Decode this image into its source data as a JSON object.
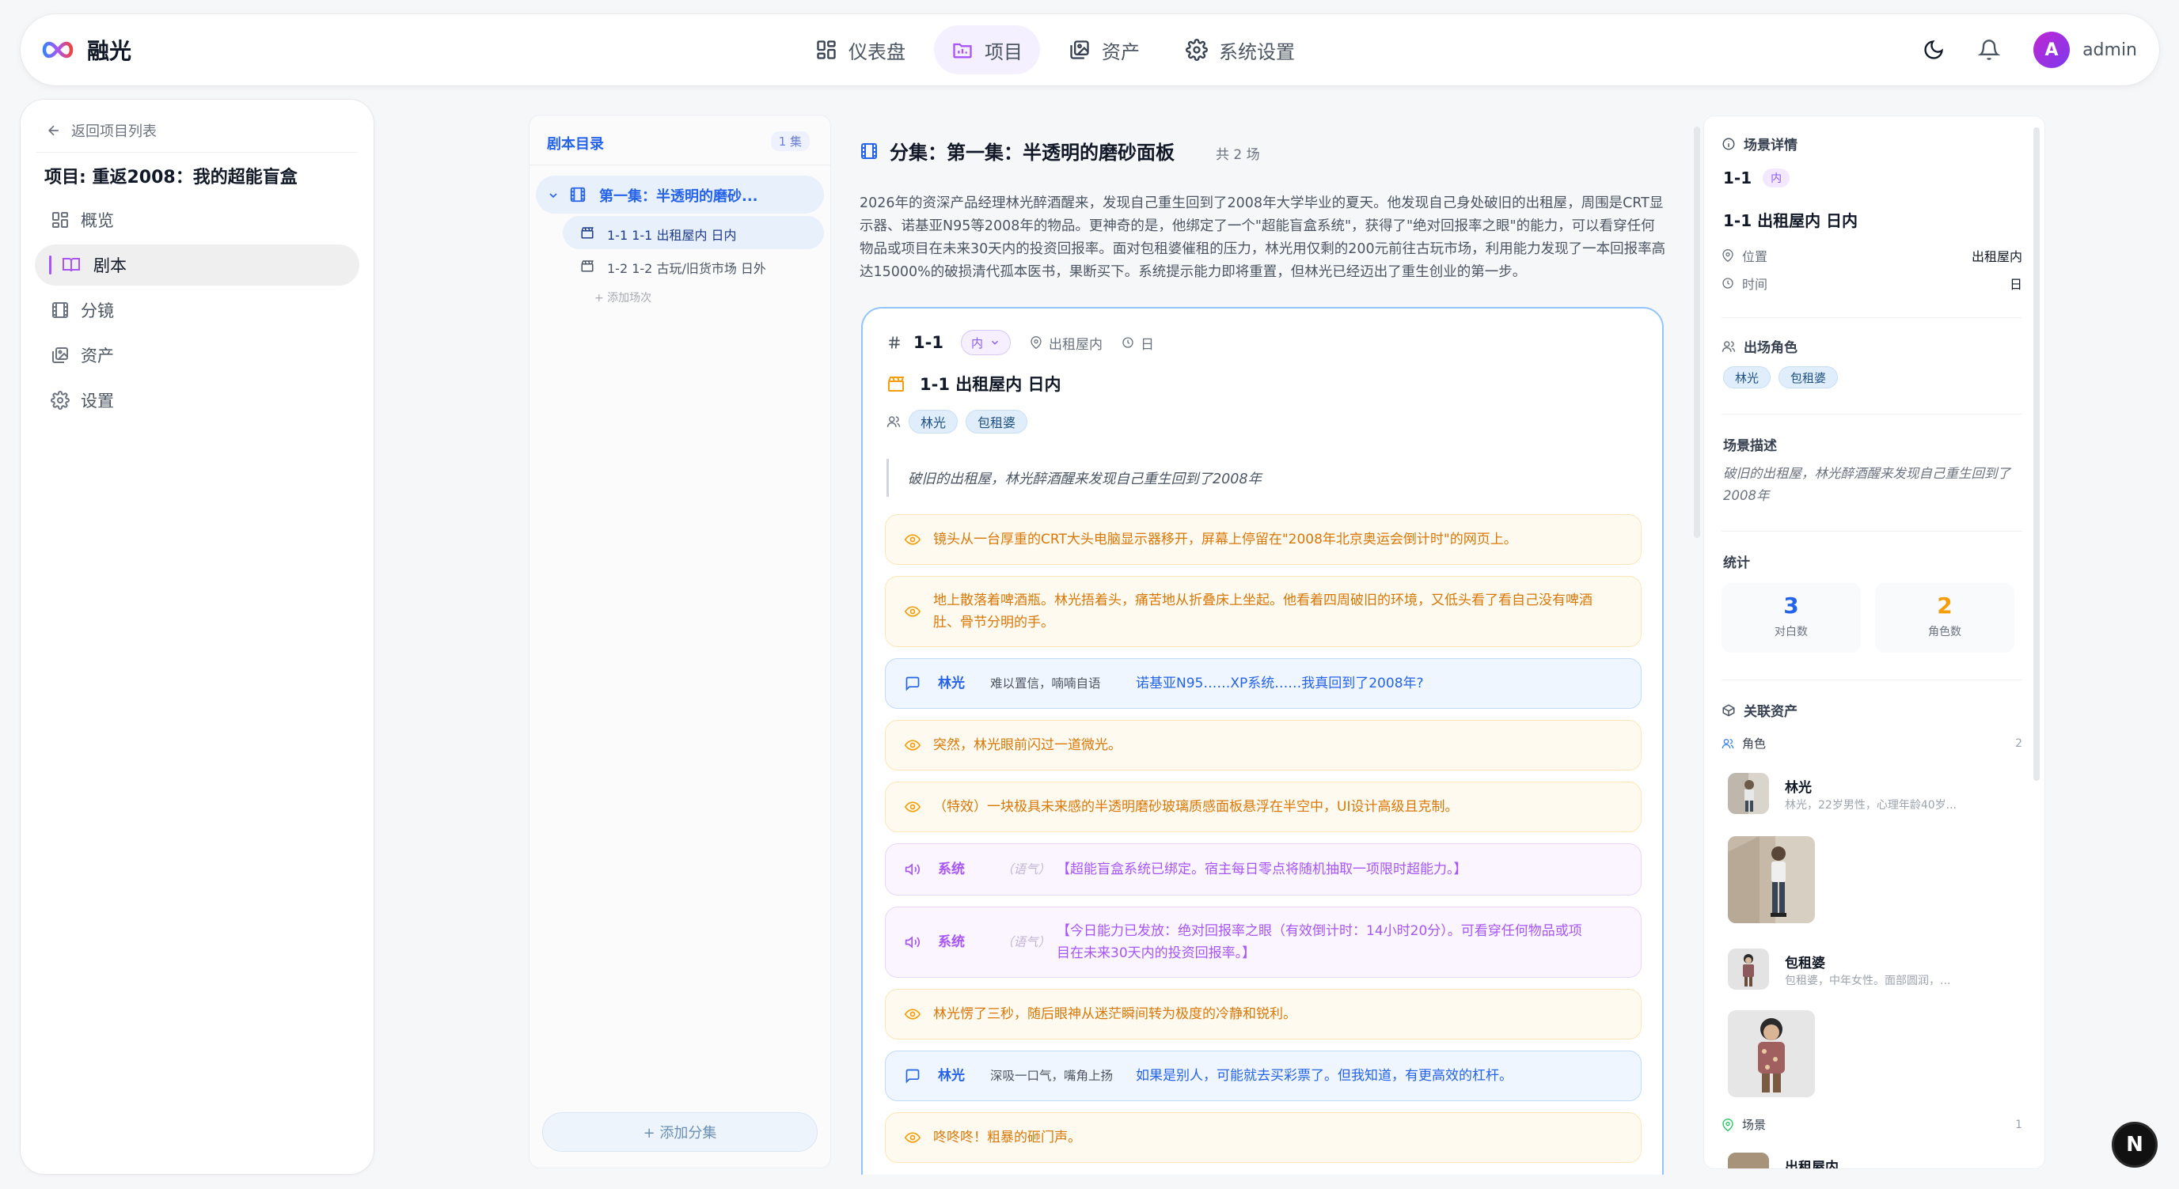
{
  "brand": {
    "name": "融光"
  },
  "nav": [
    {
      "label": "仪表盘",
      "icon": "dashboard-icon"
    },
    {
      "label": "项目",
      "icon": "project-icon",
      "active": true
    },
    {
      "label": "资产",
      "icon": "assets-icon"
    },
    {
      "label": "系统设置",
      "icon": "gear-icon"
    }
  ],
  "user": {
    "avatar_letter": "A",
    "name": "admin"
  },
  "sidebar": {
    "back_label": "返回项目列表",
    "project_title": "项目: 重返2008：我的超能盲盒",
    "items": [
      {
        "label": "概览",
        "icon": "grid-icon"
      },
      {
        "label": "剧本",
        "icon": "book-icon",
        "active": true
      },
      {
        "label": "分镜",
        "icon": "film-icon"
      },
      {
        "label": "资产",
        "icon": "images-icon"
      },
      {
        "label": "设置",
        "icon": "gear-icon"
      }
    ]
  },
  "directory": {
    "title": "剧本目录",
    "count": "1 集",
    "episode_label": "第一集：半透明的磨砂...",
    "scenes": [
      {
        "label": "1-1 1-1 出租屋内 日内"
      },
      {
        "label": "1-2 1-2 古玩/旧货市场 日外"
      }
    ],
    "add_scene": "+ 添加场次",
    "add_episode": "+ 添加分集"
  },
  "main": {
    "title": "分集：第一集：半透明的磨砂面板",
    "scene_count": "共 2 场",
    "synopsis": "2026年的资深产品经理林光醉酒醒来，发现自己重生回到了2008年大学毕业的夏天。他发现自己身处破旧的出租屋，周围是CRT显示器、诺基亚N95等2008年的物品。更神奇的是，他绑定了一个\"超能盲盒系统\"，获得了\"绝对回报率之眼\"的能力，可以看穿任何物品或项目在未来30天内的投资回报率。面对包租婆催租的压力，林光用仅剩的200元前往古玩市场，利用能力发现了一本回报率高达15000%的破损清代孤本医书，果断买下。系统提示能力即将重置，但林光已经迈出了重生创业的第一步。"
  },
  "scene": {
    "number": "1-1",
    "inout": "内",
    "location": "出租屋内",
    "time": "日",
    "heading": "1-1 出租屋内 日内",
    "characters": [
      "林光",
      "包租婆"
    ],
    "description": "破旧的出租屋，林光醉酒醒来发现自己重生回到了2008年",
    "blocks": [
      {
        "type": "action",
        "text": "镜头从一台厚重的CRT大头电脑显示器移开，屏幕上停留在\"2008年北京奥运会倒计时\"的网页上。"
      },
      {
        "type": "action",
        "text": "地上散落着啤酒瓶。林光捂着头，痛苦地从折叠床上坐起。他看着四周破旧的环境，又低头看了看自己没有啤酒肚、骨节分明的手。"
      },
      {
        "type": "dialog",
        "speaker": "林光",
        "paren": "难以置信，喃喃自语",
        "line": "诺基亚N95……XP系统……我真回到了2008年?"
      },
      {
        "type": "action",
        "text": "突然，林光眼前闪过一道微光。"
      },
      {
        "type": "action",
        "text": "（特效）一块极具未来感的半透明磨砂玻璃质感面板悬浮在半空中，UI设计高级且克制。"
      },
      {
        "type": "system",
        "speaker": "系统",
        "paren": "（语气）",
        "line": "【超能盲盒系统已绑定。宿主每日零点将随机抽取一项限时超能力。】"
      },
      {
        "type": "system",
        "speaker": "系统",
        "paren": "（语气）",
        "line": "【今日能力已发放：绝对回报率之眼（有效倒计时：14小时20分）。可看穿任何物品或项目在未来30天内的投资回报率。】"
      },
      {
        "type": "action",
        "text": "林光愣了三秒，随后眼神从迷茫瞬间转为极度的冷静和锐利。"
      },
      {
        "type": "dialog",
        "speaker": "林光",
        "paren": "深吸一口气，嘴角上扬",
        "line": "如果是别人，可能就去买彩票了。但我知道，有更高效的杠杆。"
      },
      {
        "type": "action",
        "text": "咚咚咚！粗暴的砸门声。"
      }
    ]
  },
  "detail": {
    "title": "场景详情",
    "number": "1-1",
    "inout": "内",
    "heading": "1-1 出租屋内 日内",
    "location_label": "位置",
    "location_value": "出租屋内",
    "time_label": "时间",
    "time_value": "日",
    "characters_title": "出场角色",
    "characters": [
      "林光",
      "包租婆"
    ],
    "desc_title": "场景描述",
    "desc": "破旧的出租屋，林光醉酒醒来发现自己重生回到了2008年",
    "stats_title": "统计",
    "stats": [
      {
        "value": "3",
        "label": "对白数",
        "color": "#2563eb"
      },
      {
        "value": "2",
        "label": "角色数",
        "color": "#f59e0b"
      }
    ],
    "assets_title": "关联资产",
    "roles_label": "角色",
    "roles_count": "2",
    "assets": [
      {
        "name": "林光",
        "desc": "林光，22岁男性，心理年龄40岁..."
      },
      {
        "name": "包租婆",
        "desc": "包租婆，中年女性。面部圆润，..."
      }
    ],
    "scenes_label": "场景",
    "scenes_count": "1",
    "scene_asset_name": "出租屋内"
  },
  "fab": {
    "letter": "N"
  },
  "colors": {
    "accent_purple": "#a855f7",
    "accent_blue": "#2563eb",
    "action": "#d97706",
    "system": "#a855f7"
  }
}
